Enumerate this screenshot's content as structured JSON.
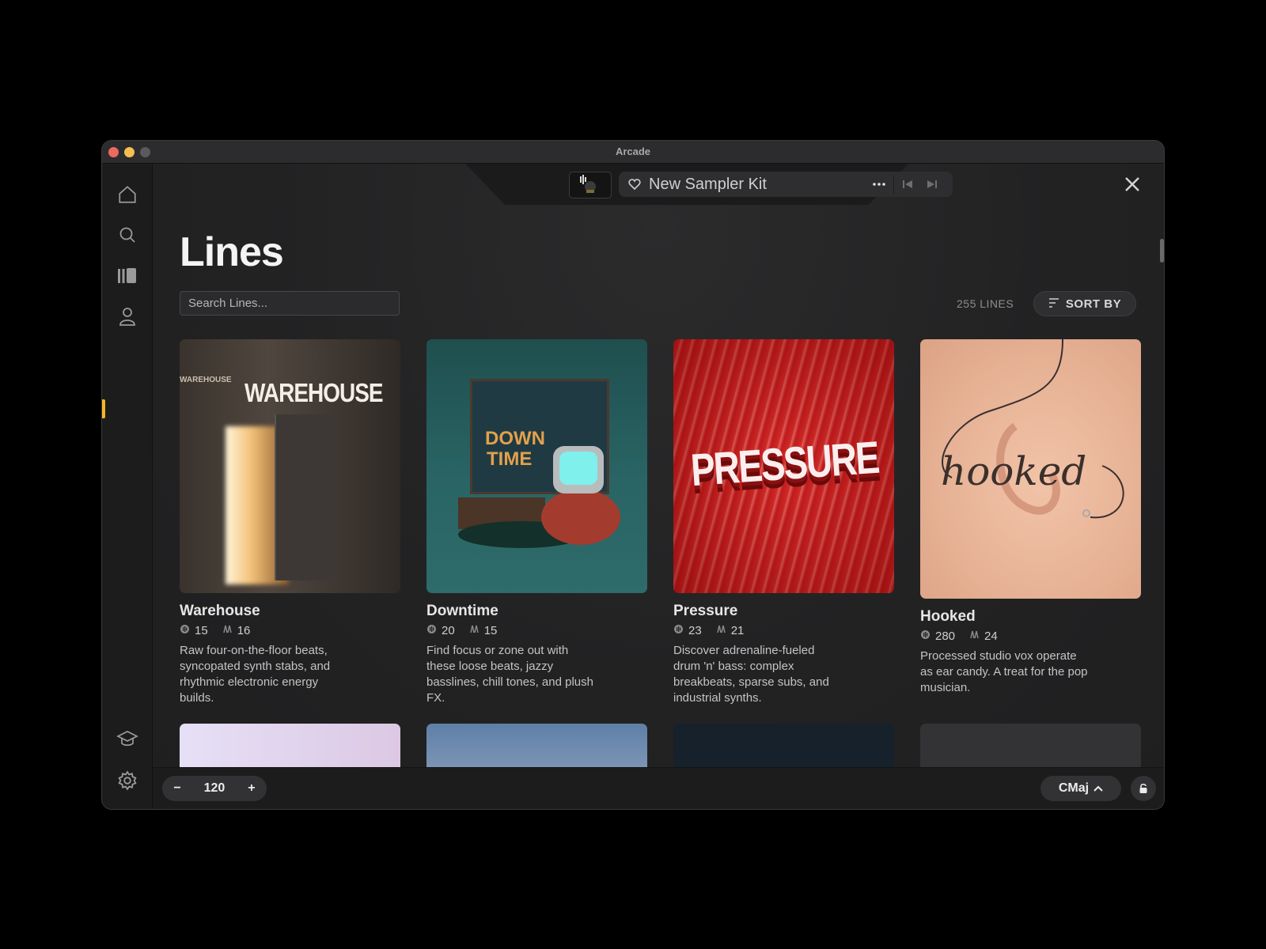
{
  "window": {
    "title": "Arcade"
  },
  "sidebar": {
    "items": [
      {
        "icon": "home-icon"
      },
      {
        "icon": "search-icon"
      },
      {
        "icon": "library-icon",
        "active": true
      },
      {
        "icon": "user-icon"
      }
    ],
    "bottom_items": [
      {
        "icon": "graduation-cap-icon"
      },
      {
        "icon": "gear-icon"
      }
    ],
    "active_color": "#f3b628"
  },
  "player": {
    "kit_name": "New Sampler Kit"
  },
  "page": {
    "title": "Lines",
    "search_placeholder": "Search Lines...",
    "count_label": "255 LINES",
    "sort_label": "SORT BY"
  },
  "cards": [
    {
      "title": "Warehouse",
      "stat1": "15",
      "stat2": "16",
      "description": "Raw four-on-the-floor beats, syncopated synth stabs, and rhythmic electronic energy builds.",
      "art_text": "WAREHOUSE",
      "art_subtext": "WAREHOUSE"
    },
    {
      "title": "Downtime",
      "stat1": "20",
      "stat2": "15",
      "description": "Find focus or zone out with these loose beats, jazzy basslines, chill tones, and plush FX.",
      "art_text": "DOWN",
      "art_text2": "TIME"
    },
    {
      "title": "Pressure",
      "stat1": "23",
      "stat2": "21",
      "description": "Discover adrenaline-fueled drum 'n' bass: complex breakbeats, sparse subs, and industrial synths.",
      "art_text": "PRESSURE"
    },
    {
      "title": "Hooked",
      "stat1": "280",
      "stat2": "24",
      "description": "Processed studio vox operate as ear candy. A treat for the pop musician.",
      "art_text": "hooked"
    }
  ],
  "bottom_bar": {
    "bpm": "120",
    "minus": "−",
    "plus": "+",
    "key": "CMaj"
  }
}
